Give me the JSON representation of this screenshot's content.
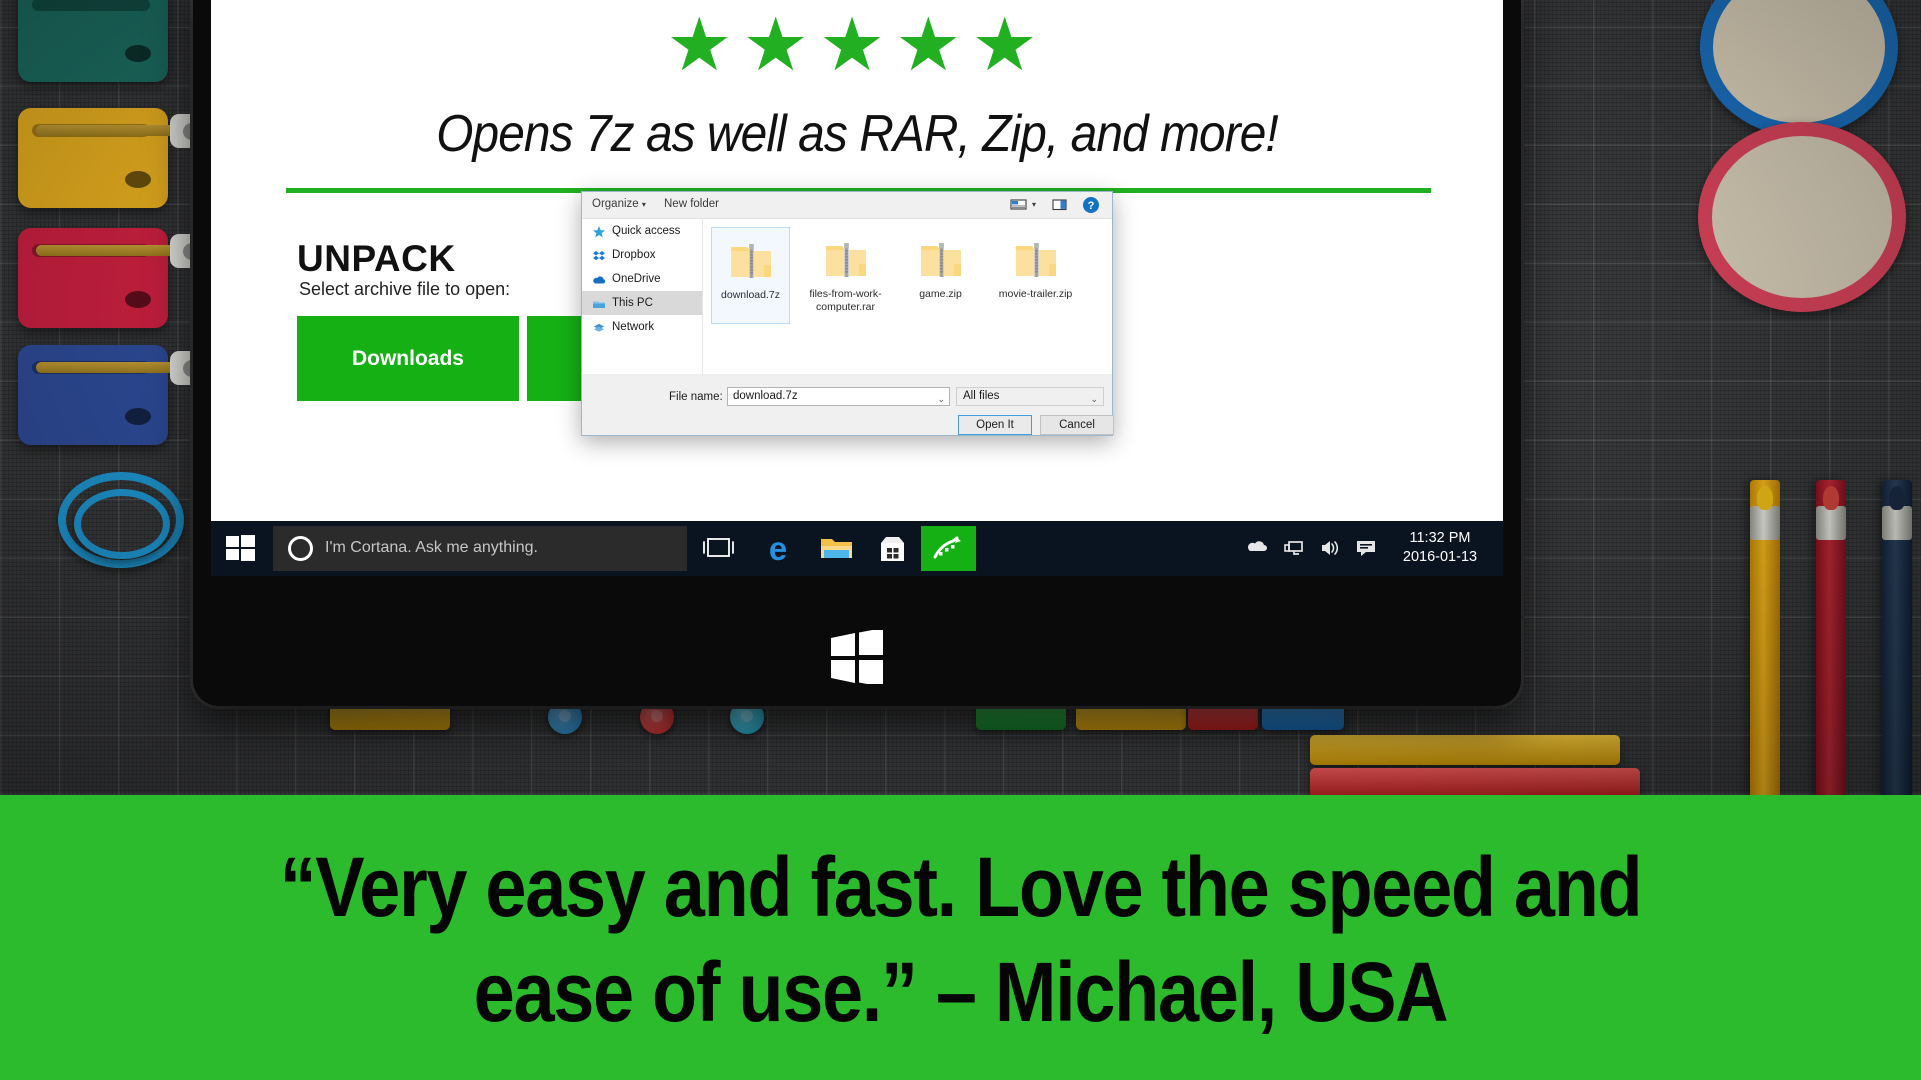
{
  "promo": {
    "rating_stars": "★★★★★",
    "rating_value": 5,
    "tagline": "Opens 7z as well as RAR, Zip, and more!",
    "accent_color": "#22b022",
    "banner_color": "#2cbb2c",
    "quote_line1": "“Very easy and fast. Love the speed and",
    "quote_line2": "ease of use.” – Michael, USA"
  },
  "app": {
    "title": "UNPACK",
    "subtitle": "Select archive file to open:",
    "buttons": [
      {
        "label": "Downloads",
        "name": "downloads-button"
      },
      {
        "label": "",
        "name": "documents-button"
      }
    ]
  },
  "dialog": {
    "toolbar": {
      "organize": "Organize",
      "organize_caret": "▾",
      "new_folder": "New folder",
      "view_icon": "view-layout-icon",
      "view_caret": "▾",
      "preview_pane_icon": "preview-pane-icon",
      "help_icon": "help-icon"
    },
    "nav_items": [
      {
        "label": "Quick access",
        "icon": "star-icon",
        "selected": false
      },
      {
        "label": "Dropbox",
        "icon": "dropbox-icon",
        "selected": false
      },
      {
        "label": "OneDrive",
        "icon": "cloud-icon",
        "selected": false
      },
      {
        "label": "This PC",
        "icon": "pc-folder-icon",
        "selected": true
      },
      {
        "label": "Network",
        "icon": "network-icon",
        "selected": false
      }
    ],
    "files": [
      {
        "name": "download.7z",
        "icon": "zipped-folder-icon",
        "selected": true
      },
      {
        "name": "files-from-work-computer.rar",
        "icon": "zipped-folder-icon",
        "selected": false
      },
      {
        "name": "game.zip",
        "icon": "zipped-folder-icon",
        "selected": false
      },
      {
        "name": "movie-trailer.zip",
        "icon": "zipped-folder-icon",
        "selected": false
      }
    ],
    "footer": {
      "file_name_label": "File name:",
      "file_name_value": "download.7z",
      "file_type_value": "All files",
      "caret": "⌄",
      "open_button": "Open It",
      "cancel_button": "Cancel"
    }
  },
  "taskbar": {
    "start_icon": "windows-start-icon",
    "cortana_placeholder": "I'm Cortana. Ask me anything.",
    "apps": [
      {
        "name": "task-view-icon",
        "label": "Task View"
      },
      {
        "name": "edge-icon",
        "label": "Microsoft Edge"
      },
      {
        "name": "file-explorer-icon",
        "label": "File Explorer"
      },
      {
        "name": "store-icon",
        "label": "Store"
      },
      {
        "name": "unpack-app-icon",
        "label": "Unpack"
      }
    ],
    "tray_icons": [
      "onedrive-tray-icon",
      "network-icon",
      "volume-icon",
      "action-center-icon"
    ],
    "time": "11:32 PM",
    "date": "2016-01-13"
  },
  "device": {
    "logo": "windows-logo"
  }
}
